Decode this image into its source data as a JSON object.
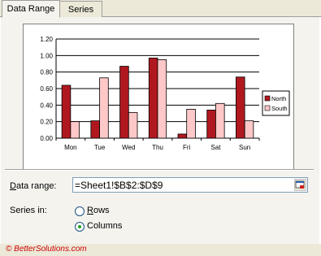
{
  "tabs": [
    {
      "label": "Data Range",
      "active": true
    },
    {
      "label": "Series",
      "active": false
    }
  ],
  "data_range": {
    "label_underlined": "D",
    "label_rest": "ata range:",
    "value": "=Sheet1!$B$2:$D$9"
  },
  "series_in": {
    "label": "Series in:",
    "options": [
      {
        "underlined": "R",
        "rest": "ows",
        "selected": false
      },
      {
        "underlined": "",
        "rest": "Columns",
        "selected": true,
        "underlined_mid": "l"
      }
    ]
  },
  "watermark": "© BetterSolutions.com",
  "chart_data": {
    "type": "bar",
    "categories": [
      "Mon",
      "Tue",
      "Wed",
      "Thu",
      "Fri",
      "Sat",
      "Sun"
    ],
    "series": [
      {
        "name": "North",
        "color": "#b01820",
        "values": [
          0.64,
          0.21,
          0.87,
          0.97,
          0.05,
          0.34,
          0.74
        ]
      },
      {
        "name": "South",
        "color": "#ffc8c8",
        "values": [
          0.2,
          0.73,
          0.31,
          0.95,
          0.35,
          0.42,
          0.21
        ]
      }
    ],
    "ylim": [
      0,
      1.2
    ],
    "yticks": [
      "0.00",
      "0.20",
      "0.40",
      "0.60",
      "0.80",
      "1.00",
      "1.20"
    ],
    "legend_position": "right",
    "grid": true,
    "title": "",
    "xlabel": "",
    "ylabel": ""
  }
}
